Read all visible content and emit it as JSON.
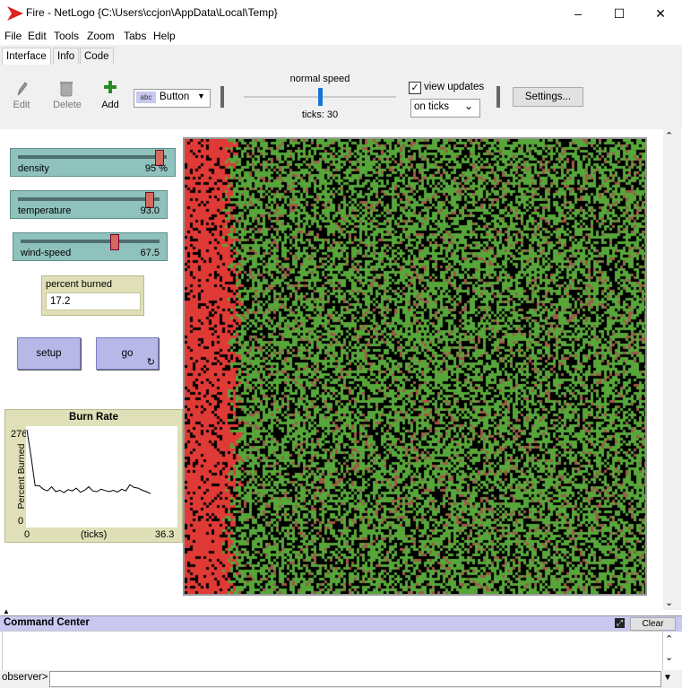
{
  "window": {
    "title": "Fire - NetLogo {C:\\Users\\ccjon\\AppData\\Local\\Temp}",
    "controls": [
      "–",
      "☐",
      "✕"
    ]
  },
  "menu": [
    "File",
    "Edit",
    "Tools",
    "Zoom",
    "Tabs",
    "Help"
  ],
  "tabs": [
    "Interface",
    "Info",
    "Code"
  ],
  "toolbar": {
    "edit": "Edit",
    "delete": "Delete",
    "add": "Add",
    "widget_type": "Button",
    "speed_label": "normal speed",
    "ticks_label": "ticks: 30",
    "speed_fraction": 0.5,
    "view_updates_label": "view updates",
    "view_updates_checked": true,
    "update_mode": "on ticks",
    "settings": "Settings..."
  },
  "sliders": [
    {
      "name": "density",
      "value": "95 %",
      "fraction": 0.95
    },
    {
      "name": "temperature",
      "value": "93.0",
      "fraction": 0.93
    },
    {
      "name": "wind-speed",
      "value": "67.5",
      "fraction": 0.675
    }
  ],
  "monitor": {
    "label": "percent burned",
    "value": "17.2"
  },
  "buttons": {
    "setup": "setup",
    "go": "go",
    "go_forever_icon": "↻"
  },
  "plot": {
    "title": "Burn Rate",
    "ylabel": "Percent Burned",
    "xlabel": "(ticks)",
    "ymax_label": "276",
    "ymin_label": "0",
    "xmin_label": "0",
    "xmax_label": "36.3"
  },
  "chart_data": {
    "type": "line",
    "title": "Burn Rate",
    "xlabel": "(ticks)",
    "ylabel": "Percent Burned",
    "xlim": [
      0,
      36.3
    ],
    "ylim": [
      0,
      276
    ],
    "x": [
      0,
      1,
      2,
      3,
      4,
      5,
      6,
      7,
      8,
      9,
      10,
      11,
      12,
      13,
      14,
      15,
      16,
      17,
      18,
      19,
      20,
      21,
      22,
      23,
      24,
      25,
      26,
      27,
      28,
      29,
      30
    ],
    "y": [
      276,
      200,
      115,
      115,
      105,
      100,
      112,
      98,
      102,
      95,
      104,
      100,
      108,
      96,
      102,
      112,
      100,
      98,
      105,
      101,
      98,
      102,
      97,
      105,
      100,
      118,
      110,
      108,
      102,
      98,
      92
    ]
  },
  "world_colors": {
    "burned": "#e03a36",
    "tree": "#57a63a",
    "ember": "#9c5b46",
    "empty": "#000000"
  },
  "command_center": {
    "title": "Command Center",
    "clear": "Clear",
    "prompt": "observer>"
  },
  "colors": {
    "slider": "#8fc2bd",
    "monitor": "#e0e0b8",
    "button": "#b8b8e8",
    "command_header": "#c8c8f0"
  }
}
